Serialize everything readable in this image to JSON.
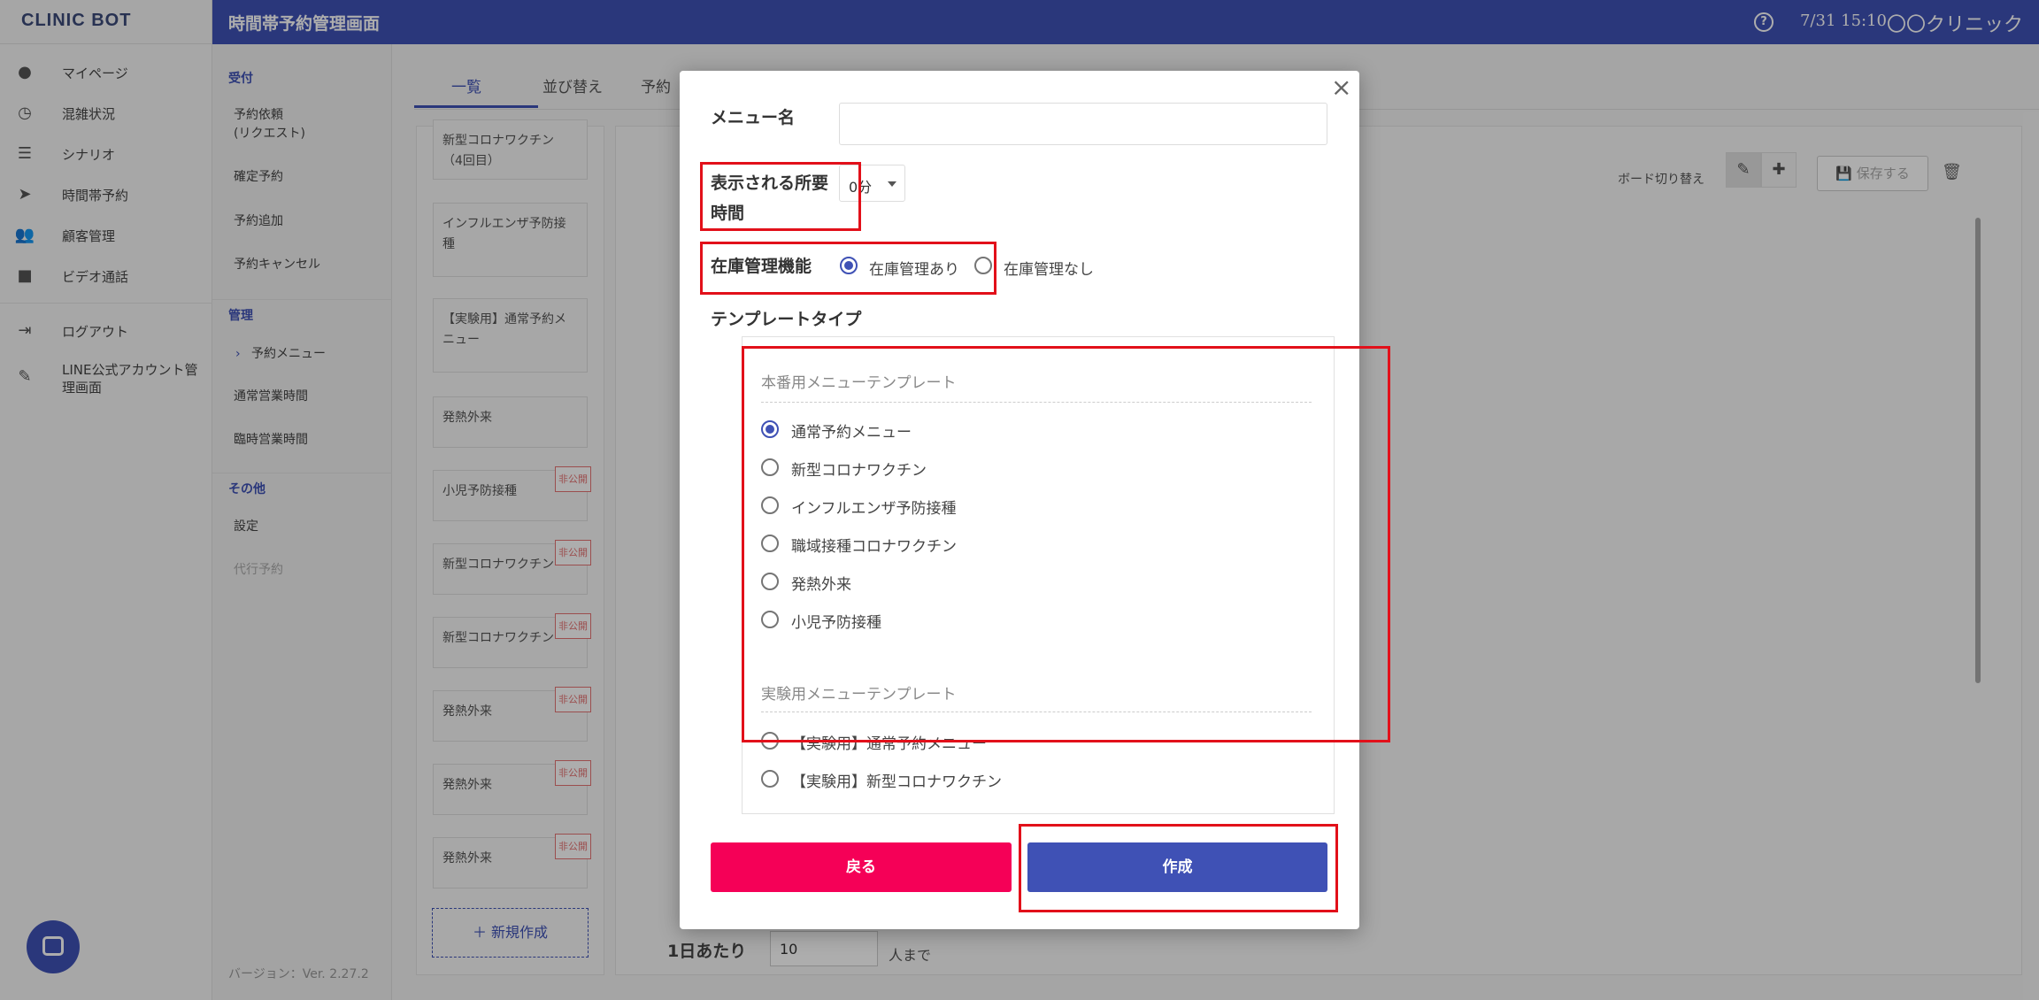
{
  "app": {
    "brand": "CLINIC BOT",
    "page_title": "時間帯予約管理画面",
    "clock": "7/31 15:10",
    "clinic_name": "〇〇クリニック"
  },
  "sidebar": {
    "items": [
      {
        "label": "マイページ",
        "icon": "user-circle-icon"
      },
      {
        "label": "混雑状況",
        "icon": "clock-icon"
      },
      {
        "label": "シナリオ",
        "icon": "list-icon"
      },
      {
        "label": "時間帯予約",
        "icon": "send-icon"
      },
      {
        "label": "顧客管理",
        "icon": "people-icon"
      },
      {
        "label": "ビデオ通話",
        "icon": "video-icon"
      },
      {
        "label": "ログアウト",
        "icon": "logout-icon"
      },
      {
        "label": "LINE公式アカウント管理画面",
        "icon": "admin-icon"
      }
    ]
  },
  "subnav": {
    "sec_reception": "受付",
    "req": "予約依頼\n(リクエスト)",
    "confirmed": "確定予約",
    "add": "予約追加",
    "cancel": "予約キャンセル",
    "sec_manage": "管理",
    "menu": "予約メニュー",
    "regular_hours": "通常営業時間",
    "temp_hours": "臨時営業時間",
    "sec_other": "その他",
    "settings": "設定",
    "proxy": "代行予約",
    "version": "バージョン：Ver. 2.27.2"
  },
  "tabs": [
    "一覧",
    "並び替え",
    "予約"
  ],
  "list": {
    "cards": [
      "新型コロナワクチン\n（4回目）",
      "インフルエンザ予防接\n種",
      "【実験用】通常予約メ\nニュー",
      "発熱外来",
      "小児予防接種",
      "新型コロナワクチン",
      "新型コロナワクチン",
      "発熱外来",
      "発熱外来",
      "発熱外来"
    ],
    "badge": "非公開",
    "new_button": "＋ 新規作成"
  },
  "detail": {
    "board_switch": "ボード切り替え",
    "save": "保存する",
    "bottom_label": "1日あたり",
    "bottom_value": "10",
    "bottom_unit": "人まで"
  },
  "modal": {
    "menu_name_label": "メニュー名",
    "menu_name_value": "",
    "duration_label": "表示される所要\n時間",
    "duration_value": "0分",
    "inventory_label": "在庫管理機能",
    "inventory_options": [
      "在庫管理あり",
      "在庫管理なし"
    ],
    "template_label": "テンプレートタイプ",
    "production_group_title": "本番用メニューテンプレート",
    "production_options": [
      "通常予約メニュー",
      "新型コロナワクチン",
      "インフルエンザ予防接種",
      "職域接種コロナワクチン",
      "発熱外来",
      "小児予防接種"
    ],
    "experimental_group_title": "実験用メニューテンプレート",
    "experimental_options": [
      "【実験用】通常予約メニュー",
      "【実験用】新型コロナワクチン"
    ],
    "back_button": "戻る",
    "create_button": "作成"
  },
  "colors": {
    "primary": "#3f51b5",
    "danger": "#f50057",
    "highlight": "#e2101a"
  }
}
